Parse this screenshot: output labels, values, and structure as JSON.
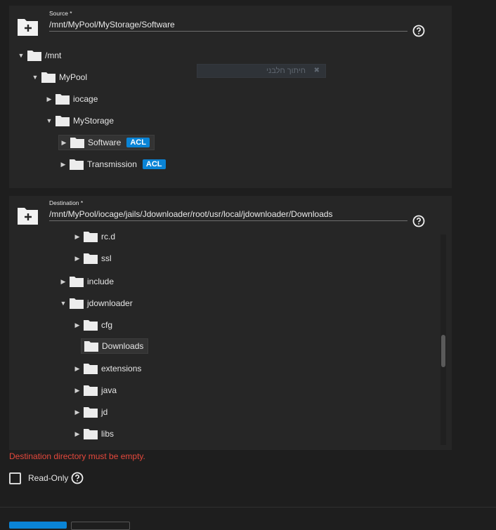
{
  "source": {
    "label": "Source *",
    "path": "/mnt/MyPool/MyStorage/Software",
    "tree": [
      {
        "label": "/mnt",
        "toggle": "▼"
      },
      {
        "label": "MyPool",
        "toggle": "▼"
      },
      {
        "label": "iocage",
        "toggle": "▶"
      },
      {
        "label": "MyStorage",
        "toggle": "▼"
      },
      {
        "label": "Software",
        "toggle": "▶",
        "badge": "ACL",
        "selected": true
      },
      {
        "label": "Transmission",
        "toggle": "▶",
        "badge": "ACL"
      }
    ]
  },
  "ghost_text": "חיתוך חלבני",
  "destination": {
    "label": "Destination *",
    "path": "/mnt/MyPool/iocage/jails/Jdownloader/root/usr/local/jdownloader/Downloads",
    "tree": [
      {
        "label": "rc.d",
        "toggle": "▶"
      },
      {
        "label": "ssl",
        "toggle": "▶"
      },
      {
        "label": "include",
        "toggle": "▶"
      },
      {
        "label": "jdownloader",
        "toggle": "▼"
      },
      {
        "label": "cfg",
        "toggle": "▶"
      },
      {
        "label": "Downloads",
        "toggle": "",
        "selected": true
      },
      {
        "label": "extensions",
        "toggle": "▶"
      },
      {
        "label": "java",
        "toggle": "▶"
      },
      {
        "label": "jd",
        "toggle": "▶"
      },
      {
        "label": "libs",
        "toggle": "▶"
      }
    ]
  },
  "error_message": "Destination directory must be empty.",
  "readonly": {
    "label": "Read-Only",
    "checked": false
  },
  "icons": {
    "add_folder": "folder-plus-icon",
    "help": "help-circle-icon",
    "folder": "folder-icon"
  }
}
